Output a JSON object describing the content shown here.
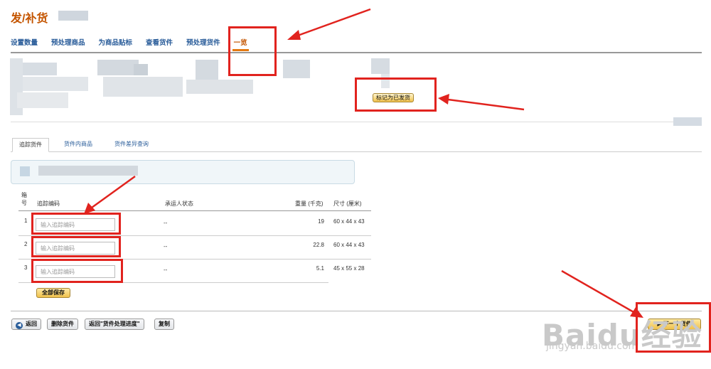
{
  "page": {
    "title": "发/补货"
  },
  "nav": {
    "tabs": [
      {
        "label": "设置数量"
      },
      {
        "label": "预处理商品"
      },
      {
        "label": "为商品贴标"
      },
      {
        "label": "查看货件"
      },
      {
        "label": "预处理货件"
      },
      {
        "label": "一览"
      }
    ],
    "active": "一览"
  },
  "summary": {
    "mark_shipped_label": "标记为已发货"
  },
  "sub_tabs": [
    {
      "label": "追踪货件"
    },
    {
      "label": "货件内商品"
    },
    {
      "label": "货件差异查询"
    }
  ],
  "table": {
    "headers": {
      "box_no": "箱号",
      "tracking": "追踪编码",
      "carrier_status": "承运人状态",
      "weight": "重量 (千克)",
      "dimensions": "尺寸 (厘米)"
    },
    "rows": [
      {
        "box": "1",
        "tracking_placeholder": "输入追踪编码",
        "status": "--",
        "weight": "19",
        "dims": "60 x 44 x 43"
      },
      {
        "box": "2",
        "tracking_placeholder": "输入追踪编码",
        "status": "--",
        "weight": "22.8",
        "dims": "60 x 44 x 43"
      },
      {
        "box": "3",
        "tracking_placeholder": "输入追踪编码",
        "status": "--",
        "weight": "5.1",
        "dims": "45 x 55 x 28"
      }
    ],
    "save_all_label": "全部保存"
  },
  "footer": {
    "back_label": "返回",
    "delete_label": "删除货件",
    "back_progress_label": "返回\"货件处理进度\"",
    "copy_label": "复制",
    "next_label": "下一个货件"
  },
  "watermark": {
    "brand": "Baidu经验",
    "url": "jingyan.baidu.com"
  },
  "colors": {
    "title": "#c45500",
    "link": "#2a5d9a",
    "button": "#f0c14b",
    "annotation": "#e1231e"
  }
}
